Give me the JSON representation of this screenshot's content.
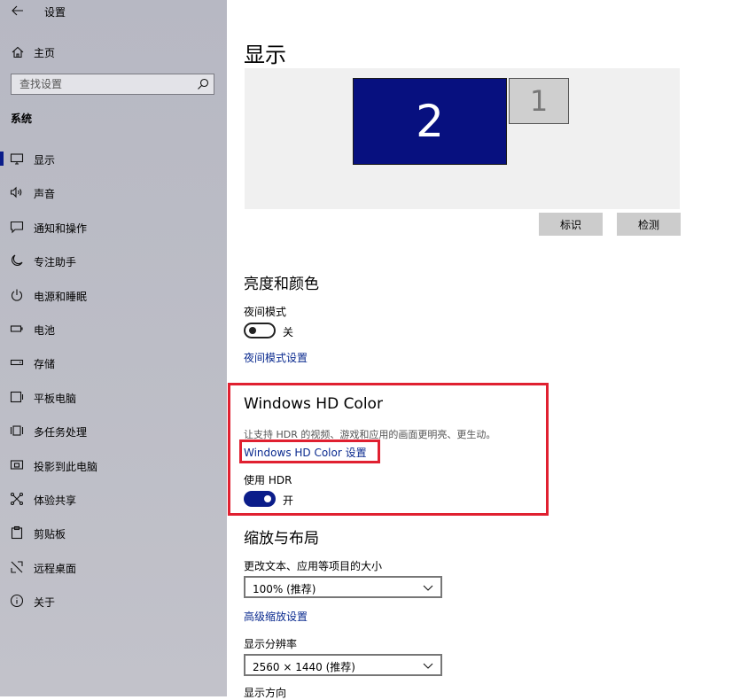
{
  "sidebar": {
    "app_title": "设置",
    "home_label": "主页",
    "search_placeholder": "查找设置",
    "section_title": "系统",
    "items": [
      {
        "label": "显示",
        "icon": "monitor-icon",
        "active": true
      },
      {
        "label": "声音",
        "icon": "speaker-icon"
      },
      {
        "label": "通知和操作",
        "icon": "notification-icon"
      },
      {
        "label": "专注助手",
        "icon": "moon-icon"
      },
      {
        "label": "电源和睡眠",
        "icon": "power-icon"
      },
      {
        "label": "电池",
        "icon": "battery-icon"
      },
      {
        "label": "存储",
        "icon": "storage-icon"
      },
      {
        "label": "平板电脑",
        "icon": "tablet-icon"
      },
      {
        "label": "多任务处理",
        "icon": "multitask-icon"
      },
      {
        "label": "投影到此电脑",
        "icon": "project-icon"
      },
      {
        "label": "体验共享",
        "icon": "share-icon"
      },
      {
        "label": "剪贴板",
        "icon": "clipboard-icon"
      },
      {
        "label": "远程桌面",
        "icon": "remote-desktop-icon"
      },
      {
        "label": "关于",
        "icon": "info-icon"
      }
    ]
  },
  "main": {
    "title": "显示",
    "monitors": {
      "primary_label": "2",
      "secondary_label": "1"
    },
    "identify_label": "标识",
    "detect_label": "检测",
    "brightness": {
      "heading": "亮度和颜色",
      "night_mode_label": "夜间模式",
      "night_mode_state": "关",
      "night_mode_link": "夜间模式设置"
    },
    "hdcolor": {
      "heading": "Windows HD Color",
      "description": "让支持 HDR 的视频、游戏和应用的画面更明亮、更生动。",
      "settings_link": "Windows HD Color 设置",
      "hdr_label": "使用 HDR",
      "hdr_state": "开"
    },
    "scale": {
      "heading": "缩放与布局",
      "text_size_label": "更改文本、应用等项目的大小",
      "text_size_value": "100% (推荐)",
      "advanced_link": "高级缩放设置",
      "resolution_label": "显示分辨率",
      "resolution_value": "2560 × 1440 (推荐)",
      "orientation_label": "显示方向"
    }
  },
  "colors": {
    "accent": "#0b1d8a",
    "highlight_box": "#e02030",
    "link": "#0a2a8f"
  }
}
